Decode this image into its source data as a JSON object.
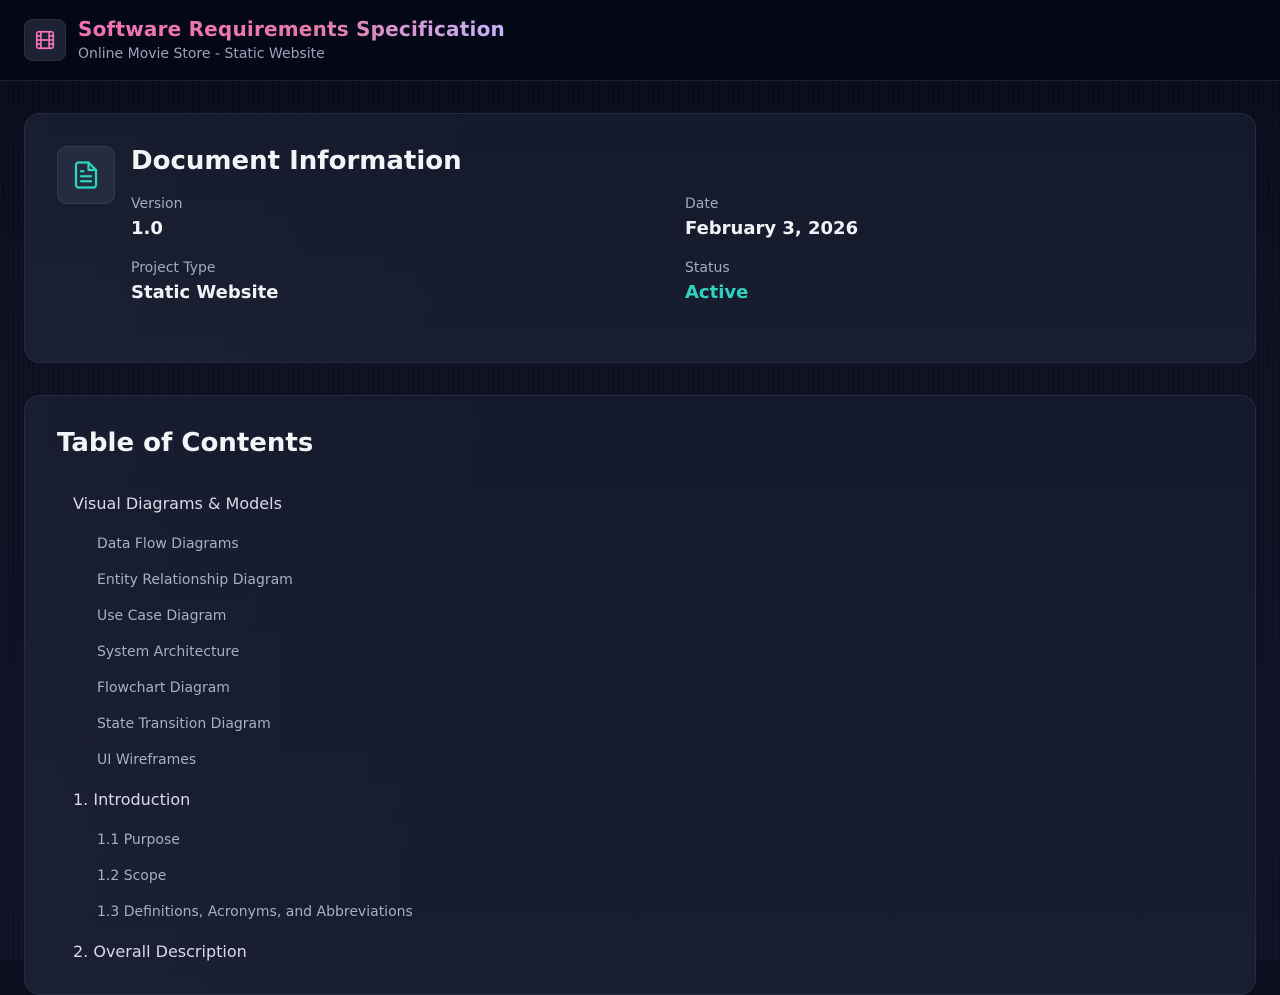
{
  "header": {
    "title": "Software Requirements Specification",
    "subtitle": "Online Movie Store - Static Website",
    "logo_icon": "film-icon"
  },
  "document_info": {
    "heading": "Document Information",
    "icon": "document-icon",
    "version_label": "Version",
    "version_value": "1.0",
    "date_label": "Date",
    "date_value": "February 3, 2026",
    "project_type_label": "Project Type",
    "project_type_value": "Static Website",
    "status_label": "Status",
    "status_value": "Active",
    "status_color": "#2dd4bf"
  },
  "toc": {
    "heading": "Table of Contents",
    "sections": [
      {
        "label": "Visual Diagrams & Models",
        "items": [
          "Data Flow Diagrams",
          "Entity Relationship Diagram",
          "Use Case Diagram",
          "System Architecture",
          "Flowchart Diagram",
          "State Transition Diagram",
          "UI Wireframes"
        ]
      },
      {
        "label": "1. Introduction",
        "items": [
          "1.1 Purpose",
          "1.2 Scope",
          "1.3 Definitions, Acronyms, and Abbreviations"
        ]
      },
      {
        "label": "2. Overall Description",
        "items": []
      }
    ]
  },
  "colors": {
    "accent_pink": "#f472b6",
    "accent_teal": "#2dd4bf",
    "background": "#0b0f1e"
  }
}
